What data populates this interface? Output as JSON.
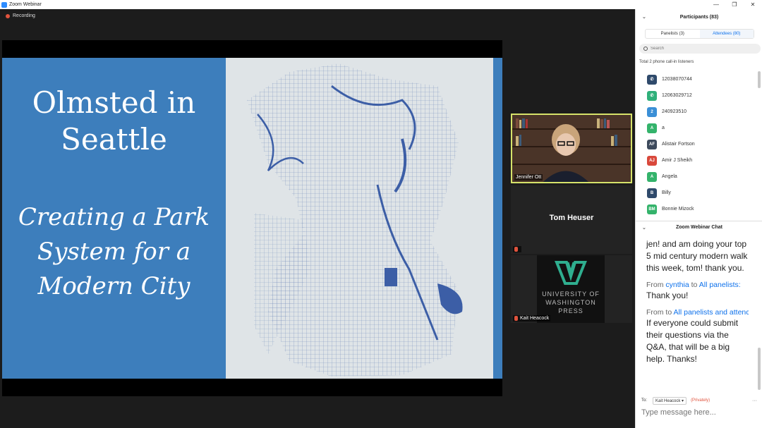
{
  "window": {
    "title": "Zoom Webinar"
  },
  "recording": {
    "label": "Recording"
  },
  "slide": {
    "title": "Olmsted in Seattle",
    "subtitle": "Creating a Park System for a Modern City",
    "color": "#3d7ebc"
  },
  "gallery": {
    "speaker": "Jennifer Ott",
    "tile2_name": "Tom Heuser",
    "tile3_name": "Kait Heacock",
    "logo_text": "UNIVERSITY OF WASHINGTON PRESS"
  },
  "participants": {
    "header": "Participants (83)",
    "tab_panelists": "Panelists (3)",
    "tab_attendees": "Attendees (80)",
    "search_placeholder": "Search",
    "phone_note": "Total 2 phone call-in listeners",
    "list": [
      {
        "name": "12038070744",
        "initials": "",
        "color": "#2f4a6b",
        "icon": "phone-icon"
      },
      {
        "name": "12063029712",
        "initials": "",
        "color": "#2fb07a",
        "icon": "phone-icon"
      },
      {
        "name": "240923510",
        "initials": "2",
        "color": "#3b8fd6",
        "icon": ""
      },
      {
        "name": "a",
        "initials": "A",
        "color": "#34b36b",
        "icon": ""
      },
      {
        "name": "Alistair Fortson",
        "initials": "AF",
        "color": "#3d4a5c",
        "icon": ""
      },
      {
        "name": "Amir J Sheikh",
        "initials": "AJ",
        "color": "#d9483b",
        "icon": ""
      },
      {
        "name": "Angela",
        "initials": "A",
        "color": "#34b36b",
        "icon": ""
      },
      {
        "name": "Billy",
        "initials": "B",
        "color": "#2f4a6b",
        "icon": ""
      },
      {
        "name": "Bonnie Mizock",
        "initials": "BM",
        "color": "#34b36b",
        "icon": ""
      }
    ]
  },
  "chat": {
    "header": "Zoom Webinar Chat",
    "partial_message": "jen! and am doing your top 5 mid century modern walk this week, tom! thank you.",
    "msg1_from_label": "From",
    "msg1_sender": "cynthia",
    "msg1_to_label": "to",
    "msg1_recipient": "All panelists:",
    "msg1_text": "Thank you!",
    "msg2_from_label": "From",
    "msg2_to_label": "to",
    "msg2_recipient": "All panelists and attenc",
    "msg2_text": "If everyone could submit their questions via the Q&A, that will be a big help. Thanks!",
    "to_label": "To:",
    "to_value": "Kait Heacock",
    "privately": "(Privately)",
    "more": "···",
    "input_placeholder": "Type message here..."
  }
}
